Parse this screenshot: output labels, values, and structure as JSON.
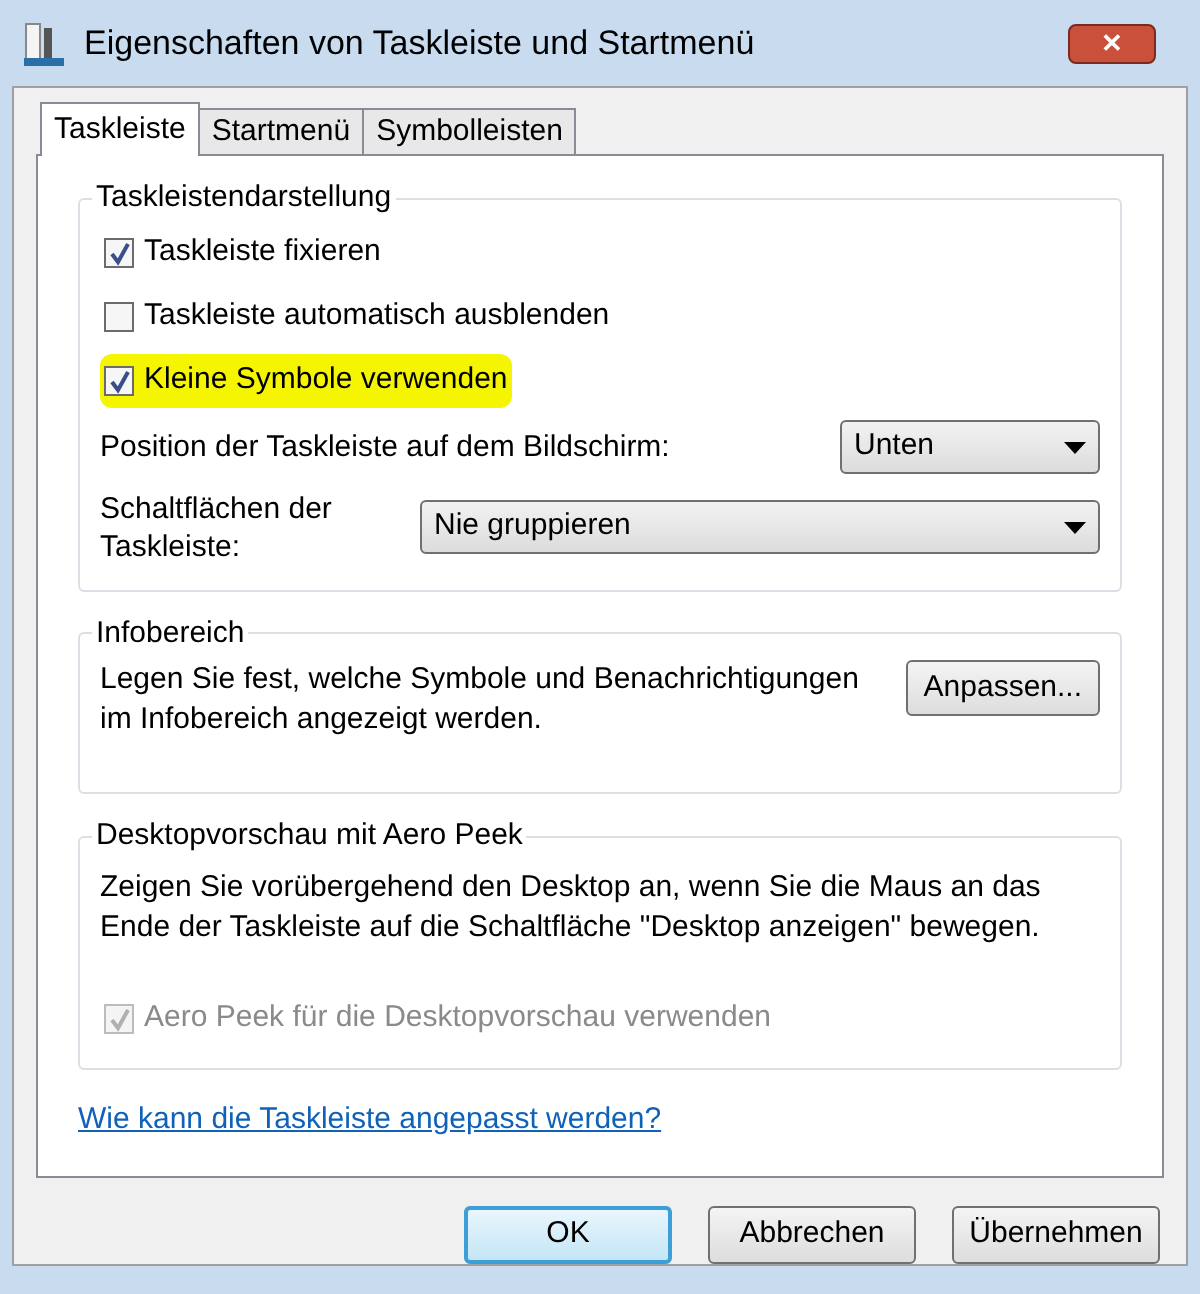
{
  "window": {
    "title": "Eigenschaften von Taskleiste und Startmenü",
    "close": "✕"
  },
  "tabs": [
    {
      "label": "Taskleiste",
      "selected": true
    },
    {
      "label": "Startmenü",
      "selected": false
    },
    {
      "label": "Symbolleisten",
      "selected": false
    }
  ],
  "groups": [
    {
      "title": "Taskleistendarstellung",
      "items": [
        {
          "kind": "checkbox",
          "label": "Taskleiste fixieren",
          "checked": true,
          "highlighted": false,
          "disabled": false
        },
        {
          "kind": "checkbox",
          "label": "Taskleiste automatisch ausblenden",
          "checked": false,
          "highlighted": false,
          "disabled": false
        },
        {
          "kind": "checkbox",
          "label": "Kleine Symbole verwenden",
          "checked": true,
          "highlighted": true,
          "disabled": false
        },
        {
          "kind": "dropdown",
          "label": "Position der Taskleiste auf dem Bildschirm:",
          "value": "Unten",
          "wide": false
        },
        {
          "kind": "dropdown",
          "label": "Schaltflächen der Taskleiste:",
          "value": "Nie gruppieren",
          "wide": true
        }
      ]
    },
    {
      "title": "Infobereich",
      "items": [
        {
          "kind": "text_button",
          "text": "Legen Sie fest, welche Symbole und Benachrichtigungen im Infobereich angezeigt werden.",
          "button": "Anpassen..."
        }
      ]
    },
    {
      "title": "Desktopvorschau mit Aero Peek",
      "items": [
        {
          "kind": "text",
          "text": "Zeigen Sie vorübergehend den Desktop an, wenn Sie die Maus an das Ende der Taskleiste auf die Schaltfläche \"Desktop anzeigen\" bewegen."
        },
        {
          "kind": "checkbox",
          "label": "Aero Peek für die Desktopvorschau verwenden",
          "checked": true,
          "highlighted": false,
          "disabled": true
        }
      ]
    }
  ],
  "help_link": "Wie kann die Taskleiste angepasst werden?",
  "buttons": [
    {
      "label": "OK",
      "default": true
    },
    {
      "label": "Abbrechen",
      "default": false
    },
    {
      "label": "Übernehmen",
      "default": false
    }
  ]
}
